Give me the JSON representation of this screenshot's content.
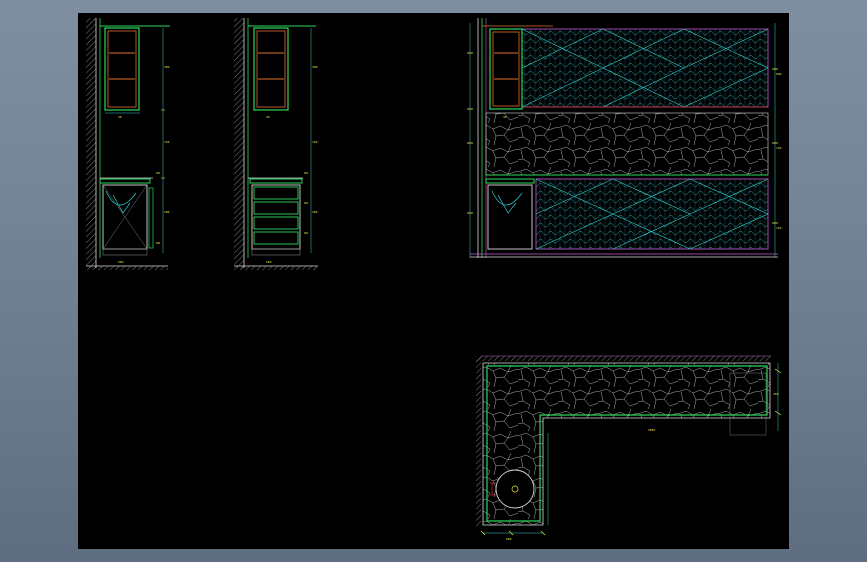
{
  "drawing": {
    "background": "#000000",
    "frame_background": "#6f7f91",
    "views": [
      {
        "name": "cabinet-section-a",
        "labels": [
          "300",
          "720",
          "180",
          "560",
          "30"
        ]
      },
      {
        "name": "cabinet-section-b",
        "labels": [
          "300",
          "720",
          "180",
          "560",
          "30"
        ]
      },
      {
        "name": "wall-elevation",
        "labels": [
          "600",
          "740",
          "720",
          "30"
        ]
      },
      {
        "name": "countertop-plan",
        "labels": [
          "2050",
          "600",
          "450"
        ]
      }
    ],
    "colors": {
      "cyan": "#2fd0d0",
      "green": "#2bd65a",
      "yellow": "#f5e642",
      "magenta": "#c85ad8",
      "orange": "#e0702a",
      "white": "#d8d8d8",
      "gray": "#7a7a7a",
      "red": "#d23030"
    }
  }
}
